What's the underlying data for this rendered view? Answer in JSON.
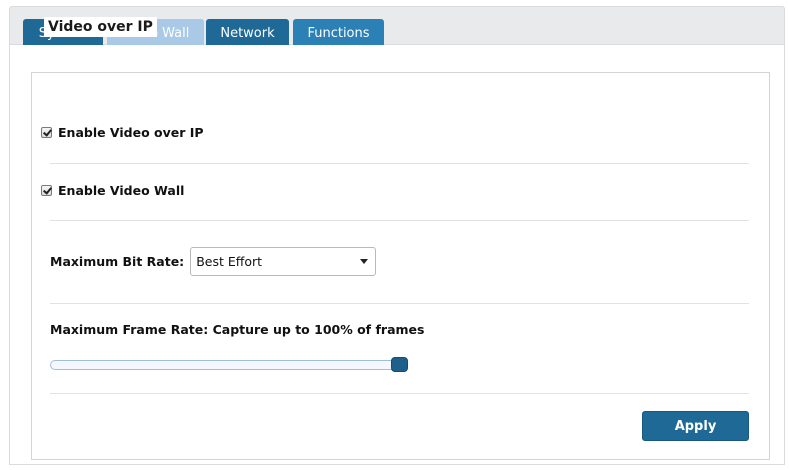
{
  "tabs": [
    {
      "label": "System",
      "state": "normal"
    },
    {
      "label": "Video Wall",
      "state": "active"
    },
    {
      "label": "Network",
      "state": "normal"
    },
    {
      "label": "Functions",
      "state": "normal"
    }
  ],
  "section": {
    "legend": "Video over IP"
  },
  "enable_video_over_ip": {
    "label": "Enable Video over IP",
    "checked": true
  },
  "enable_video_wall": {
    "label": "Enable Video Wall",
    "checked": true
  },
  "bit_rate": {
    "label": "Maximum Bit Rate:",
    "selected": "Best Effort"
  },
  "frame_rate": {
    "label": "Maximum Frame Rate: Capture up to 100% of frames",
    "percent": 100
  },
  "apply_label": "Apply",
  "colors": {
    "tab_dark": "#1f6996",
    "tab_light": "#a9c9e6",
    "accent": "#1f6996"
  }
}
